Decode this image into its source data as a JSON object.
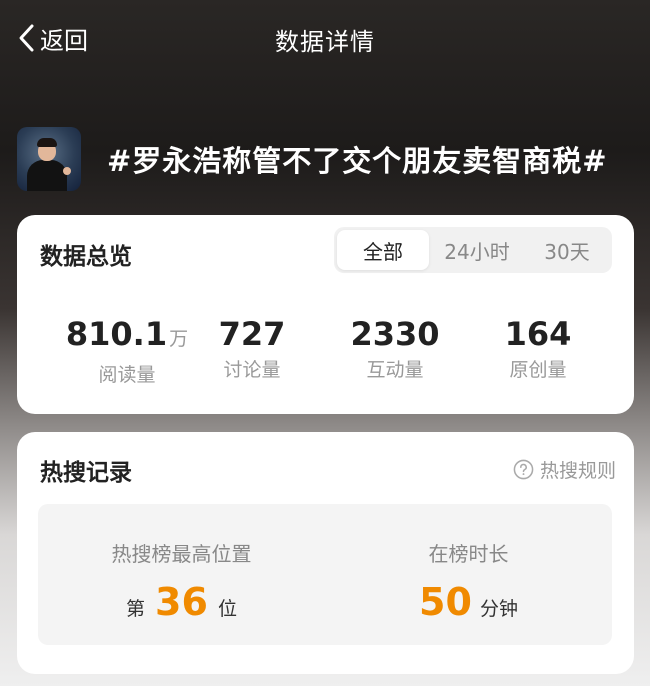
{
  "header": {
    "back_label": "返回",
    "title": "数据详情"
  },
  "topic": {
    "title": "#罗永浩称管不了交个朋友卖智商税#"
  },
  "overview": {
    "title": "数据总览",
    "tabs": [
      {
        "label": "全部",
        "active": true
      },
      {
        "label": "24小时",
        "active": false
      },
      {
        "label": "30天",
        "active": false
      }
    ],
    "stats": [
      {
        "value": "810.1",
        "unit": "万",
        "label": "阅读量"
      },
      {
        "value": "727",
        "unit": "",
        "label": "讨论量"
      },
      {
        "value": "2330",
        "unit": "",
        "label": "互动量"
      },
      {
        "value": "164",
        "unit": "",
        "label": "原创量"
      }
    ]
  },
  "records": {
    "title": "热搜记录",
    "rules_label": "热搜规则",
    "rules_icon": "question-circle-icon",
    "peak": {
      "label": "热搜榜最高位置",
      "prefix": "第",
      "value": "36",
      "suffix": "位"
    },
    "duration": {
      "label": "在榜时长",
      "value": "50",
      "suffix": "分钟"
    }
  },
  "colors": {
    "accent": "#f08a00",
    "card_bg": "#ffffff",
    "muted_text": "#999999"
  }
}
